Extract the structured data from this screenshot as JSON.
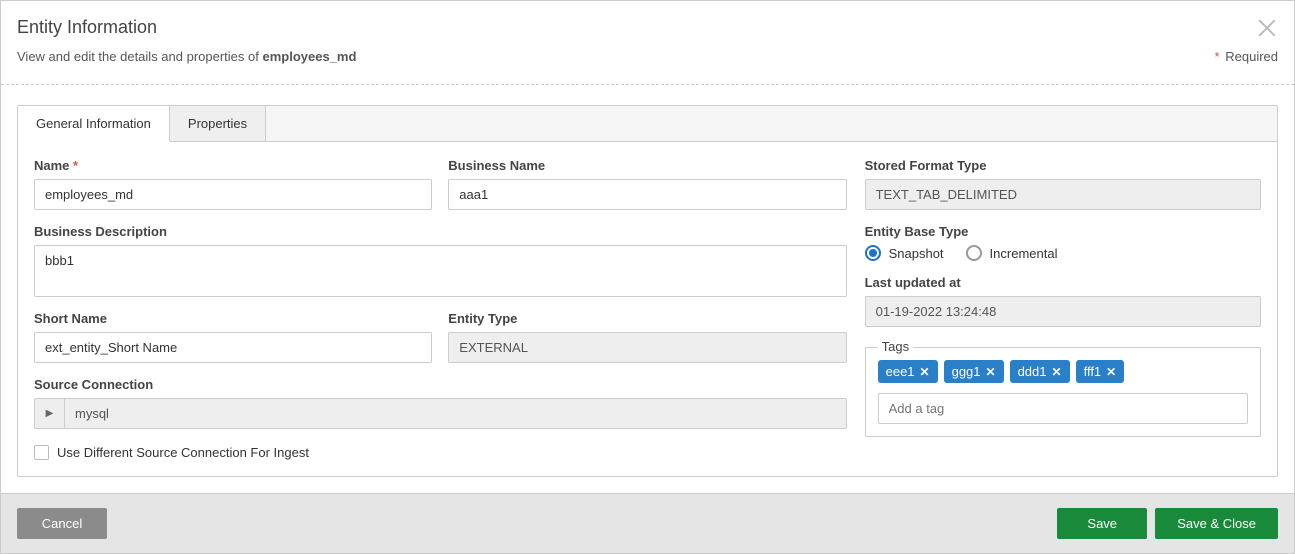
{
  "header": {
    "title": "Entity Information",
    "subtitle_prefix": "View and edit the details and properties of ",
    "entity_name": "employees_md",
    "required_label": "Required"
  },
  "tabs": [
    {
      "label": "General Information",
      "active": true
    },
    {
      "label": "Properties",
      "active": false
    }
  ],
  "fields": {
    "name": {
      "label": "Name",
      "value": "employees_md",
      "required": true
    },
    "business_name": {
      "label": "Business Name",
      "value": "aaa1"
    },
    "business_description": {
      "label": "Business Description",
      "value": "bbb1"
    },
    "short_name": {
      "label": "Short Name",
      "value": "ext_entity_Short Name"
    },
    "entity_type": {
      "label": "Entity Type",
      "value": "EXTERNAL"
    },
    "source_connection": {
      "label": "Source Connection",
      "value": "mysql"
    },
    "use_different_source": {
      "label": "Use Different Source Connection For Ingest",
      "checked": false
    },
    "stored_format_type": {
      "label": "Stored Format Type",
      "value": "TEXT_TAB_DELIMITED"
    },
    "entity_base_type": {
      "label": "Entity Base Type",
      "options": [
        {
          "label": "Snapshot",
          "checked": true
        },
        {
          "label": "Incremental",
          "checked": false
        }
      ]
    },
    "last_updated": {
      "label": "Last updated at",
      "value": "01-19-2022 13:24:48"
    },
    "tags": {
      "label": "Tags",
      "items": [
        "eee1",
        "ggg1",
        "ddd1",
        "fff1"
      ],
      "placeholder": "Add a tag"
    }
  },
  "footer": {
    "cancel": "Cancel",
    "save": "Save",
    "save_close": "Save & Close"
  }
}
